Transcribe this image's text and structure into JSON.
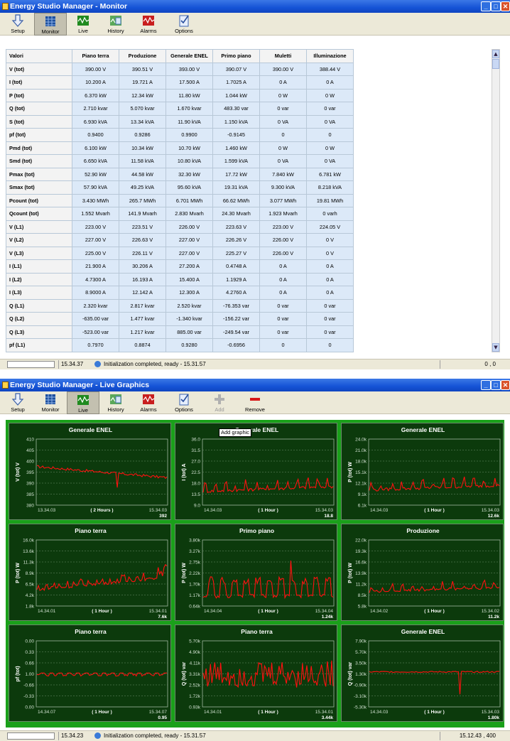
{
  "windows": [
    {
      "title": "Energy Studio Manager - Monitor",
      "toolbar": [
        {
          "label": "Setup",
          "icon": "arrow-down-icon"
        },
        {
          "label": "Monitor",
          "icon": "monitor-grid-icon",
          "active": true
        },
        {
          "label": "Live",
          "icon": "live-chart-icon"
        },
        {
          "label": "History",
          "icon": "history-chart-icon"
        },
        {
          "label": "Alarms",
          "icon": "alarm-chart-icon"
        },
        {
          "label": "Options",
          "icon": "checklist-icon"
        }
      ],
      "status": {
        "time": "15.34.37",
        "message": "Initialization completed, ready - 15.31.57",
        "coords": "0 , 0"
      }
    },
    {
      "title": "Energy Studio Manager - Live Graphics",
      "toolbar": [
        {
          "label": "Setup",
          "icon": "arrow-down-icon"
        },
        {
          "label": "Monitor",
          "icon": "monitor-grid-icon"
        },
        {
          "label": "Live",
          "icon": "live-chart-icon",
          "active": true
        },
        {
          "label": "History",
          "icon": "history-chart-icon"
        },
        {
          "label": "Alarms",
          "icon": "alarm-chart-icon"
        },
        {
          "label": "Options",
          "icon": "checklist-icon"
        },
        {
          "label": "Add",
          "icon": "plus-icon",
          "disabled": true
        },
        {
          "label": "Remove",
          "icon": "minus-icon"
        }
      ],
      "status": {
        "time": "15.34.23",
        "message": "Initialization completed, ready - 15.31.57",
        "coords": "15.12.43 , 400"
      },
      "tooltip": "Add graphic"
    }
  ],
  "monitor_table": {
    "columns": [
      "Valori",
      "Piano terra",
      "Produzione",
      "Generale ENEL",
      "Primo piano",
      "Muletti",
      "Illuminazione"
    ],
    "rows": [
      [
        "V (tot)",
        "390.00 V",
        "390.51 V",
        "393.00 V",
        "390.07 V",
        "390.00 V",
        "388.44 V"
      ],
      [
        "I (tot)",
        "10.200 A",
        "19.721 A",
        "17.500 A",
        "1.7025 A",
        "0 A",
        "0 A"
      ],
      [
        "P (tot)",
        "6.370 kW",
        "12.34 kW",
        "11.80 kW",
        "1.044 kW",
        "0 W",
        "0 W"
      ],
      [
        "Q (tot)",
        "2.710 kvar",
        "5.070 kvar",
        "1.670 kvar",
        "483.30 var",
        "0 var",
        "0 var"
      ],
      [
        "S (tot)",
        "6.930 kVA",
        "13.34 kVA",
        "11.90 kVA",
        "1.150 kVA",
        "0 VA",
        "0 VA"
      ],
      [
        "pf (tot)",
        "0.9400",
        "0.9286",
        "0.9900",
        "-0.9145",
        "0",
        "0"
      ],
      [
        "Pmd (tot)",
        "6.100 kW",
        "10.34 kW",
        "10.70 kW",
        "1.460 kW",
        "0 W",
        "0 W"
      ],
      [
        "Smd (tot)",
        "6.650 kVA",
        "11.58 kVA",
        "10.80 kVA",
        "1.599 kVA",
        "0 VA",
        "0 VA"
      ],
      [
        "Pmax (tot)",
        "52.90 kW",
        "44.58 kW",
        "32.30 kW",
        "17.72 kW",
        "7.840 kW",
        "6.781 kW"
      ],
      [
        "Smax (tot)",
        "57.90 kVA",
        "49.25 kVA",
        "95.60 kVA",
        "19.31 kVA",
        "9.300 kVA",
        "8.218 kVA"
      ],
      [
        "Pcount (tot)",
        "3.430 MWh",
        "265.7 MWh",
        "6.701 MWh",
        "66.62 MWh",
        "3.077 MWh",
        "19.81 MWh"
      ],
      [
        "Qcount (tot)",
        "1.552 Mvarh",
        "141.9 Mvarh",
        "2.830 Mvarh",
        "24.30 Mvarh",
        "1.923 Mvarh",
        "0 varh"
      ],
      [
        "V (L1)",
        "223.00 V",
        "223.51 V",
        "226.00 V",
        "223.63 V",
        "223.00 V",
        "224.05 V"
      ],
      [
        "V (L2)",
        "227.00 V",
        "226.63 V",
        "227.00 V",
        "226.26 V",
        "226.00 V",
        "0 V"
      ],
      [
        "V (L3)",
        "225.00 V",
        "226.11 V",
        "227.00 V",
        "225.27 V",
        "226.00 V",
        "0 V"
      ],
      [
        "I (L1)",
        "21.900 A",
        "30.206 A",
        "27.200 A",
        "0.4748 A",
        "0 A",
        "0 A"
      ],
      [
        "I (L2)",
        "4.7300 A",
        "16.193 A",
        "15.400 A",
        "1.1929 A",
        "0 A",
        "0 A"
      ],
      [
        "I (L3)",
        "8.9000 A",
        "12.142 A",
        "12.300 A",
        "4.2760 A",
        "0 A",
        "0 A"
      ],
      [
        "Q (L1)",
        "2.320 kvar",
        "2.817 kvar",
        "2.520 kvar",
        "-76.353 var",
        "0 var",
        "0 var"
      ],
      [
        "Q (L2)",
        "-635.00 var",
        "1.477 kvar",
        "-1.340 kvar",
        "-156.22 var",
        "0 var",
        "0 var"
      ],
      [
        "Q (L3)",
        "-523.00 var",
        "1.217 kvar",
        "885.00 var",
        "-249.54 var",
        "0 var",
        "0 var"
      ],
      [
        "pf (L1)",
        "0.7970",
        "0.8874",
        "0.9280",
        "-0.6956",
        "0",
        "0"
      ]
    ]
  },
  "colors": {
    "chart_bg": "#0c3a0c",
    "chart_frame": "#1aa01a",
    "series": "#ff1010",
    "table_cell": "#dce9f8"
  },
  "chart_data": [
    {
      "type": "line",
      "title": "Generale ENEL",
      "ylabel": "V (tot) V",
      "yticks": [
        "410",
        "405",
        "400",
        "395",
        "390",
        "385",
        "380"
      ],
      "ylim": [
        380,
        410
      ],
      "x_start": "13.34.03",
      "x_end": "15.34.03",
      "period": "( 2 Hours )",
      "current": "392",
      "shape": "voltage",
      "base": 396,
      "end": 392
    },
    {
      "type": "line",
      "title": "Generale ENEL",
      "ylabel": "I (tot) A",
      "yticks": [
        "36.0",
        "31.5",
        "27.0",
        "22.5",
        "18.0",
        "13.5",
        "9.0"
      ],
      "ylim": [
        9,
        36
      ],
      "x_start": "14.34.03",
      "x_end": "15.34.03",
      "period": "( 1 Hour )",
      "current": "18.8",
      "shape": "spiky",
      "base": 14,
      "amp": 5
    },
    {
      "type": "line",
      "title": "Generale ENEL",
      "ylabel": "P (tot) W",
      "yticks": [
        "24.0k",
        "21.0k",
        "18.0k",
        "15.1k",
        "12.1k",
        "9.1k",
        "6.1k"
      ],
      "ylim": [
        6100,
        24000
      ],
      "x_start": "14.34.03",
      "x_end": "15.34.03",
      "period": "( 1 Hour )",
      "current": "12.6k",
      "shape": "spiky",
      "base": 9800,
      "amp": 3200
    },
    {
      "type": "line",
      "title": "Piano terra",
      "ylabel": "P (tot) W",
      "yticks": [
        "16.0k",
        "13.6k",
        "11.3k",
        "8.9k",
        "6.5k",
        "4.2k",
        "1.8k"
      ],
      "ylim": [
        1800,
        16000
      ],
      "x_start": "14.34.01",
      "x_end": "15.34.01",
      "period": "( 1 Hour )",
      "current": "7.6k",
      "shape": "rising",
      "base": 5000,
      "amp": 3000
    },
    {
      "type": "line",
      "title": "Primo piano",
      "ylabel": "P (tot) W",
      "yticks": [
        "3.80k",
        "3.27k",
        "2.75k",
        "2.22k",
        "1.70k",
        "1.17k",
        "0.64k"
      ],
      "ylim": [
        640,
        3800
      ],
      "x_start": "14.34.04",
      "x_end": "15.34.04",
      "period": "( 1 Hour )",
      "current": "1.24k",
      "shape": "square",
      "base": 1200,
      "amp": 700
    },
    {
      "type": "line",
      "title": "Produzione",
      "ylabel": "P (tot) W",
      "yticks": [
        "22.0k",
        "19.3k",
        "16.6k",
        "13.9k",
        "11.2k",
        "8.5k",
        "5.8k"
      ],
      "ylim": [
        5800,
        22000
      ],
      "x_start": "14.34.02",
      "x_end": "15.34.02",
      "period": "( 1 Hour )",
      "current": "11.2k",
      "shape": "spiky",
      "base": 9000,
      "amp": 2600
    },
    {
      "type": "line",
      "title": "Piano terra",
      "ylabel": "pf (tot)",
      "yticks": [
        "0.00",
        "0.33",
        "0.66",
        "1.00",
        "-0.66",
        "-0.33",
        "0.00"
      ],
      "ylim": [
        0,
        6
      ],
      "x_start": "14.34.07",
      "x_end": "15.34.07",
      "period": "( 1 Hour )",
      "current": "0.95",
      "shape": "pfsquare",
      "base": 3,
      "amp": 0.25
    },
    {
      "type": "line",
      "title": "Piano terra",
      "ylabel": "Q (tot) var",
      "yticks": [
        "5.70k",
        "4.90k",
        "4.11k",
        "3.31k",
        "2.52k",
        "1.72k",
        "0.93k"
      ],
      "ylim": [
        930,
        5700
      ],
      "x_start": "14.34.01",
      "x_end": "15.34.01",
      "period": "( 1 Hour )",
      "current": "3.44k",
      "shape": "wild",
      "base": 2900,
      "amp": 1100
    },
    {
      "type": "line",
      "title": "Generale ENEL",
      "ylabel": "Q (tot) var",
      "yticks": [
        "7.90k",
        "5.70k",
        "3.50k",
        "1.30k",
        "-0.90k",
        "-3.10k",
        "-5.30k"
      ],
      "ylim": [
        -5300,
        7900
      ],
      "x_start": "14.34.03",
      "x_end": "15.34.03",
      "period": "( 1 Hour )",
      "current": "1.80k",
      "shape": "flatdip",
      "base": 1700,
      "amp": 250
    }
  ]
}
